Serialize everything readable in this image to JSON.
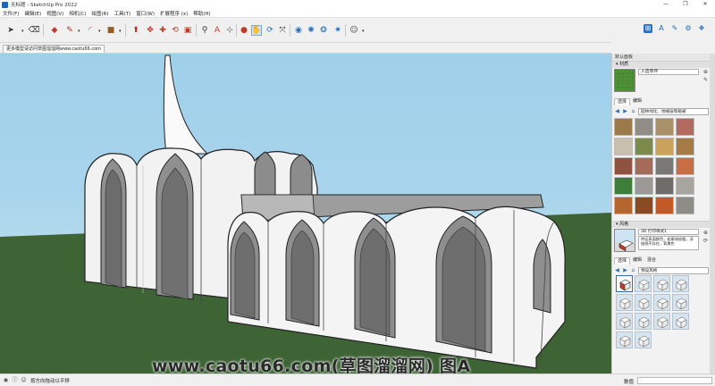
{
  "window": {
    "title": "无标题 - SketchUp Pro 2022",
    "controls": [
      "—",
      "❐",
      "✕"
    ]
  },
  "menu": [
    "文件(F)",
    "编辑(E)",
    "视图(V)",
    "相机(C)",
    "绘图(R)",
    "工具(T)",
    "窗口(W)",
    "扩展程序 (x)",
    "帮助(H)"
  ],
  "scene_tab": "更多模型请访问草图溜溜网www.caotu66.com",
  "watermark": "www.caotu66.com(草图溜溜网) 图A",
  "tray": {
    "title": "默认面板",
    "materials": {
      "header": "▾ 材质",
      "current_name": "人造草坪",
      "tabs": [
        "选择",
        "编辑"
      ],
      "library": "园林绿化、地被层和植被"
    },
    "styles": {
      "header": "▾ 风格",
      "name": "3D 打印样式1",
      "description": "特征表面颜色，轮廓线较粗，深描线不存在，背景色",
      "tabs": [
        "选择",
        "编辑",
        "混合"
      ],
      "library": "预设风格"
    }
  },
  "status": {
    "hint": "按方向拖动以平移",
    "measure_label": "数值",
    "measure_value": ""
  },
  "colors": {
    "sky": "#a9d5ec",
    "ground": "#3e6436",
    "accent": "#2a6fb8"
  }
}
